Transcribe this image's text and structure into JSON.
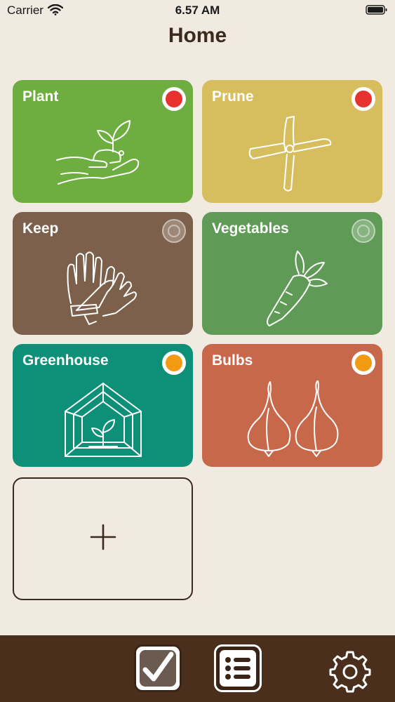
{
  "status_bar": {
    "carrier": "Carrier",
    "time": "6.57 AM"
  },
  "header": {
    "title": "Home"
  },
  "tiles": [
    {
      "label": "Plant",
      "color": "#6EAD3F",
      "status": "red",
      "status_color": "#E8322F",
      "icon": "hand-seedling-icon"
    },
    {
      "label": "Prune",
      "color": "#D6BE5E",
      "status": "red",
      "status_color": "#E8322F",
      "icon": "pruning-shears-icon"
    },
    {
      "label": "Keep",
      "color": "#7C604B",
      "status": "inactive",
      "icon": "gloves-icon"
    },
    {
      "label": "Vegetables",
      "color": "#5F9A56",
      "status": "inactive",
      "icon": "carrot-icon"
    },
    {
      "label": "Greenhouse",
      "color": "#0E8F78",
      "status": "orange",
      "status_color": "#F39A12",
      "icon": "greenhouse-icon"
    },
    {
      "label": "Bulbs",
      "color": "#C8684A",
      "status": "orange",
      "status_color": "#F39A12",
      "icon": "bulbs-icon"
    }
  ],
  "add_tile": {
    "icon": "plus-icon"
  },
  "tab_bar": {
    "background": "#4A2F1C",
    "items": [
      "checklist-icon",
      "list-icon",
      "gear-icon"
    ]
  }
}
